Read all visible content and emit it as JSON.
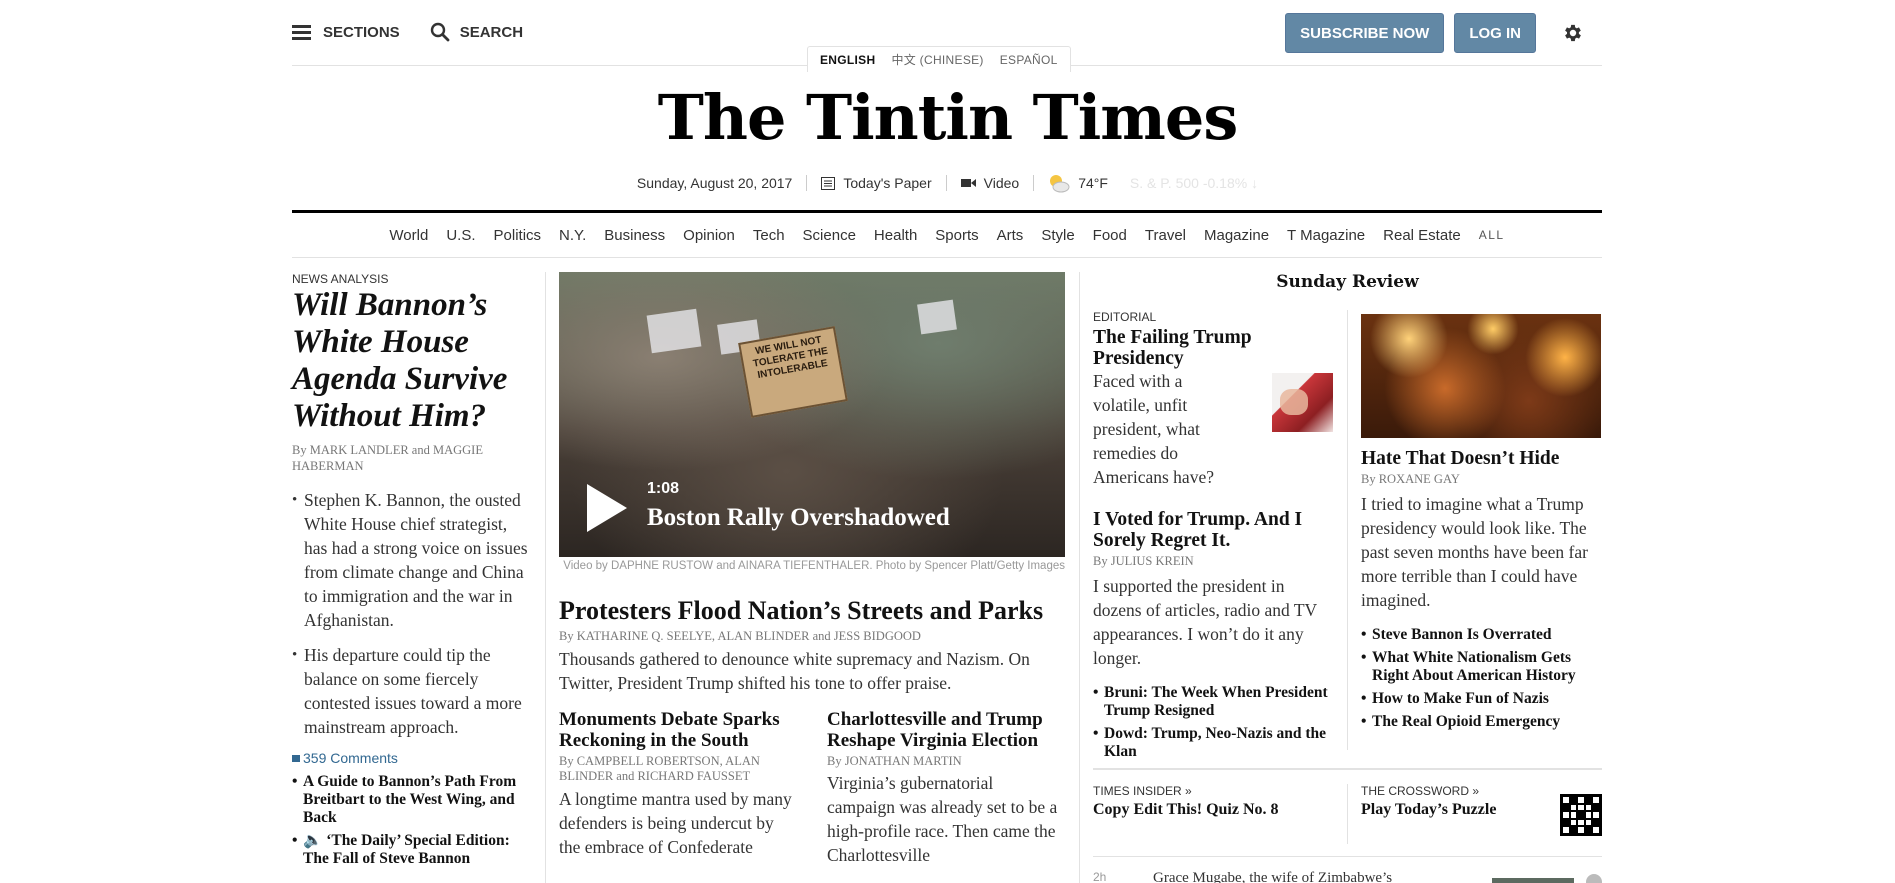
{
  "topbar": {
    "sections_label": "SECTIONS",
    "search_label": "SEARCH",
    "subscribe_label": "SUBSCRIBE NOW",
    "login_label": "LOG IN",
    "languages": [
      "ENGLISH",
      "中文 (CHINESE)",
      "ESPAÑOL"
    ],
    "accent_color": "#6288a5"
  },
  "masthead": {
    "logo": "The Tintin Times",
    "date": "Sunday, August 20, 2017",
    "todays_paper": "Today's Paper",
    "video": "Video",
    "weather": "74°F",
    "market": "S. & P. 500 -0.18% ↓"
  },
  "nav": {
    "items": [
      "World",
      "U.S.",
      "Politics",
      "N.Y.",
      "Business",
      "Opinion",
      "Tech",
      "Science",
      "Health",
      "Sports",
      "Arts",
      "Style",
      "Food",
      "Travel",
      "Magazine",
      "T Magazine",
      "Real Estate"
    ],
    "all_label": "ALL"
  },
  "left": {
    "kicker": "NEWS ANALYSIS",
    "headline": "Will Bannon’s White House Agenda Survive Without Him?",
    "byline": "By MARK LANDLER and MAGGIE HABERMAN",
    "bullets": [
      "Stephen K. Bannon, the ousted White House chief strategist, has had a strong voice on issues from climate change and China to immigration and the war in Afghanistan.",
      "His departure could tip the balance on some fiercely contested issues toward a more mainstream approach."
    ],
    "comments": "359 Comments",
    "related": [
      "A Guide to Bannon’s Path From Breitbart to the West Wing, and Back",
      "‘The Daily’ Special Edition: The Fall of Steve Bannon"
    ]
  },
  "center": {
    "video": {
      "duration": "1:08",
      "title": "Boston Rally Overshadowed",
      "sign_text": "WE WILL NOT TOLERATE THE INTOLERABLE"
    },
    "credit": "Video by DAPHNE RUSTOW and AINARA TIEFENTHALER. Photo by Spencer Platt/Getty Images",
    "headline": "Protesters Flood Nation’s Streets and Parks",
    "byline": "By KATHARINE Q. SEELYE, ALAN BLINDER and JESS BIDGOOD",
    "summary": "Thousands gathered to denounce white supremacy and Nazism. On Twitter, President Trump shifted his tone to offer praise.",
    "sub1": {
      "headline": "Monuments Debate Sparks Reckoning in the South",
      "byline": "By CAMPBELL ROBERTSON, ALAN BLINDER and RICHARD FAUSSET",
      "summary": "A longtime mantra used by many defenders is being undercut by the embrace of Confederate"
    },
    "sub2": {
      "headline": "Charlottesville and Trump Reshape Virginia Election",
      "byline": "By JONATHAN MARTIN",
      "summary": "Virginia’s gubernatorial campaign was already set to be a high-profile race. Then came the Charlottesville"
    }
  },
  "right": {
    "section_title": "Sunday Review",
    "editorial": {
      "kicker": "EDITORIAL",
      "headline": "The Failing Trump Presidency",
      "summary": "Faced with a volatile, unfit president, what remedies do Americans have?"
    },
    "story2": {
      "headline": "I Voted for Trump. And I Sorely Regret It.",
      "byline": "By JULIUS KREIN",
      "summary": "I supported the president in dozens of articles, radio and TV appearances. I won’t do it any longer."
    },
    "related1": [
      "Bruni: The Week When President Trump Resigned",
      "Dowd: Trump, Neo-Nazis and the Klan"
    ],
    "story3": {
      "headline": "Hate That Doesn’t Hide",
      "byline": "By ROXANE GAY",
      "summary": "I tried to imagine what a Trump presidency would look like. The past seven months have been far more terrible than I could have imagined."
    },
    "related2": [
      "Steve Bannon Is Overrated",
      "What White Nationalism Gets Right About American History",
      "How to Make Fun of Nazis",
      "The Real Opioid Emergency"
    ],
    "times_insider": {
      "kicker": "TIMES INSIDER »",
      "headline": "Copy Edit This! Quiz No. 8"
    },
    "crossword": {
      "kicker": "THE CROSSWORD »",
      "headline": "Play Today’s Puzzle"
    },
    "ticker": {
      "time": "2h",
      "text": "Grace Mugabe, the wife of Zimbabwe’s"
    }
  }
}
